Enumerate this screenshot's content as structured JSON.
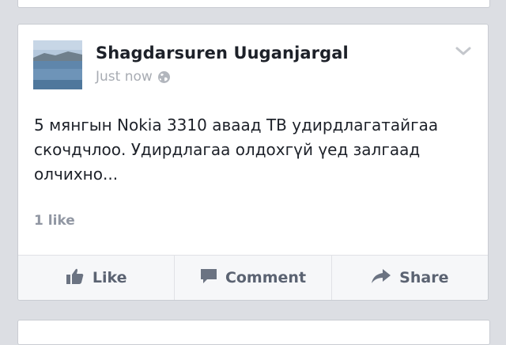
{
  "post": {
    "author": "Shagdarsuren Uuganjargal",
    "timestamp": "Just now",
    "privacy_icon": "globe-icon",
    "text": "5 мянгын Nokia 3310 аваад ТВ удирдлагатайгаа\nскочдчлоо. Удирдлагаа олдохгүй үед залгаад\nолчихно...",
    "likes": "1 like"
  },
  "actions": {
    "like_label": "Like",
    "comment_label": "Comment",
    "share_label": "Share"
  },
  "icons": {
    "menu": "chevron-down-icon",
    "like": "thumbs-up-icon",
    "comment": "comment-bubble-icon",
    "share": "share-arrow-icon"
  },
  "colors": {
    "background": "#dcdee3",
    "card": "#ffffff",
    "text": "#1d2129",
    "muted": "#9197a3",
    "action_text": "#5b6372"
  }
}
